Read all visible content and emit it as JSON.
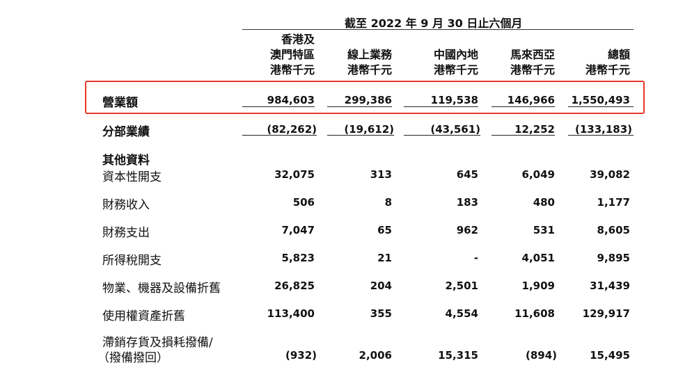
{
  "period_title": "截至 2022 年 9 月 30 日止六個月",
  "columns": [
    {
      "line1": "香港及",
      "line2": "澳門特區",
      "unit": "港幣千元"
    },
    {
      "line1": "",
      "line2": "線上業務",
      "unit": "港幣千元"
    },
    {
      "line1": "",
      "line2": "中國內地",
      "unit": "港幣千元"
    },
    {
      "line1": "",
      "line2": "馬來西亞",
      "unit": "港幣千元"
    },
    {
      "line1": "",
      "line2": "總額",
      "unit": "港幣千元"
    }
  ],
  "revenue": {
    "label": "營業額",
    "values": [
      "984,603",
      "299,386",
      "119,538",
      "146,966",
      "1,550,493"
    ]
  },
  "segment": {
    "label": "分部業績",
    "values": [
      "(82,262)",
      "(19,612)",
      "(43,561)",
      "12,252",
      "(133,183)"
    ]
  },
  "other_info_title": "其他資料",
  "other_rows": [
    {
      "label": "資本性開支",
      "values": [
        "32,075",
        "313",
        "645",
        "6,049",
        "39,082"
      ]
    },
    {
      "label": "財務收入",
      "values": [
        "506",
        "8",
        "183",
        "480",
        "1,177"
      ]
    },
    {
      "label": "財務支出",
      "values": [
        "7,047",
        "65",
        "962",
        "531",
        "8,605"
      ]
    },
    {
      "label": "所得稅開支",
      "values": [
        "5,823",
        "21",
        "-",
        "4,051",
        "9,895"
      ]
    },
    {
      "label": "物業、機器及設備折舊",
      "values": [
        "26,825",
        "204",
        "2,501",
        "1,909",
        "31,439"
      ]
    },
    {
      "label": "使用權資產折舊",
      "values": [
        "113,400",
        "355",
        "4,554",
        "11,608",
        "129,917"
      ]
    }
  ],
  "last_row": {
    "label_line1": "滯銷存貨及損耗撥備/",
    "label_line2": "（撥備撥回）",
    "values": [
      "(932)",
      "2,006",
      "15,315",
      "(894)",
      "15,495"
    ]
  },
  "colors": {
    "highlight_border": "#e8362d"
  }
}
